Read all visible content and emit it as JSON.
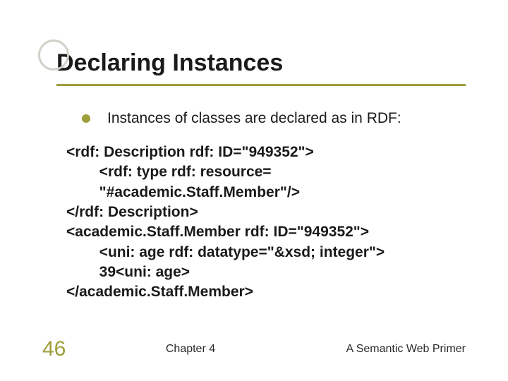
{
  "title": "Declaring Instances",
  "bullet": "Instances of classes are declared as in RDF:",
  "code": {
    "l1": "<rdf: Description rdf: ID=\"949352\">",
    "l2": "        <rdf: type rdf: resource=",
    "l3": "        \"#academic.Staff.Member\"/>",
    "l4": "</rdf: Description>",
    "l5": "<academic.Staff.Member rdf: ID=\"949352\">",
    "l6": "        <uni: age rdf: datatype=\"&xsd; integer\">",
    "l7": "        39<uni: age>",
    "l8": "</academic.Staff.Member>"
  },
  "footer": {
    "slide_number": "46",
    "center": "Chapter 4",
    "right": "A Semantic Web Primer"
  }
}
